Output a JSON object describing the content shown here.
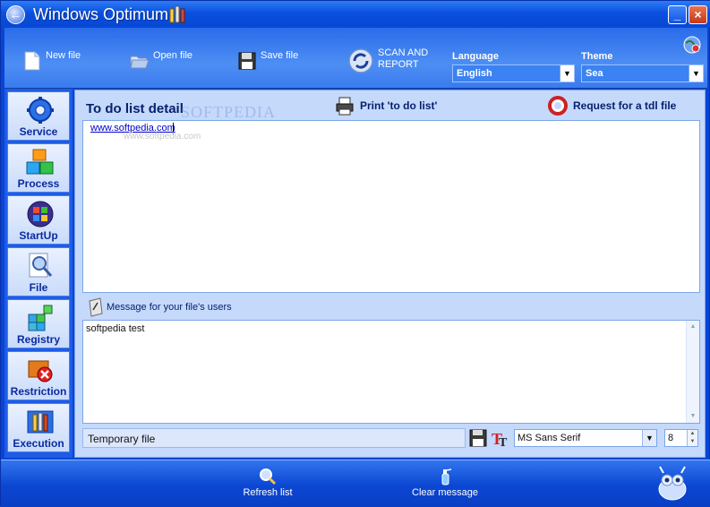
{
  "window": {
    "title": "Windows Optimum",
    "minimize_label": "_",
    "close_label": "×"
  },
  "toolbar": {
    "new_file": "New file",
    "open_file": "Open file",
    "save_file": "Save file",
    "scan_line1": "SCAN AND",
    "scan_line2": "REPORT",
    "language_label": "Language",
    "language_value": "English",
    "theme_label": "Theme",
    "theme_value": "Sea"
  },
  "sidebar": {
    "items": [
      {
        "label": "Service",
        "icon": "gear-icon"
      },
      {
        "label": "Process",
        "icon": "cubes-icon"
      },
      {
        "label": "StartUp",
        "icon": "windows-logo-icon"
      },
      {
        "label": "File",
        "icon": "magnifier-file-icon"
      },
      {
        "label": "Registry",
        "icon": "registry-cubes-icon"
      },
      {
        "label": "Restriction",
        "icon": "restriction-icon"
      },
      {
        "label": "Execution",
        "icon": "tools-icon"
      }
    ]
  },
  "main": {
    "todo_title": "To do list detail",
    "watermark": "SOFTPEDIA",
    "print_label": "Print 'to do list'",
    "request_label": "Request for a tdl file",
    "todo_text": "www.softpedia.com",
    "todo_watermark": "www.softpedia.com",
    "message_label": "Message for your file's users",
    "message_text": "softpedia test",
    "temp_file": "Temporary file",
    "font_name": "MS Sans Serif",
    "font_size": "8"
  },
  "bottom": {
    "refresh_label": "Refresh list",
    "clear_label": "Clear message"
  },
  "colors": {
    "titlebar": "#0a4fe0",
    "panel": "#c5d9fb",
    "label_text": "#06216e"
  }
}
